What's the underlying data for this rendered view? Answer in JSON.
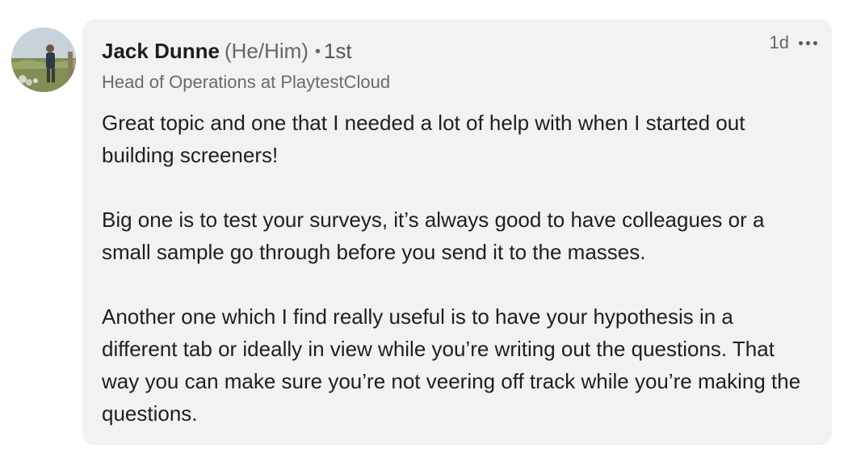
{
  "author": {
    "name": "Jack Dunne",
    "pronouns": "(He/Him)",
    "separator": "•",
    "connection_degree": "1st",
    "headline": "Head of Operations at PlaytestCloud"
  },
  "meta": {
    "timestamp": "1d",
    "more_icon": "more-horizontal-icon"
  },
  "comment": {
    "paragraphs": [
      "Great topic and one that I needed a lot of help with when I started out building screeners!",
      "Big one is to test your surveys, it’s always good to have colleagues or a small sample go through before you send it to the masses.",
      "Another one which I find really useful is to have your hypothesis in a different tab or ideally in view while you’re writing out the questions. That way you can make sure you’re not veering off track while you’re making the questions."
    ]
  },
  "colors": {
    "bubble_background": "#f2f2f2",
    "name_text": "#1d1d1d",
    "secondary_text": "#666666"
  }
}
